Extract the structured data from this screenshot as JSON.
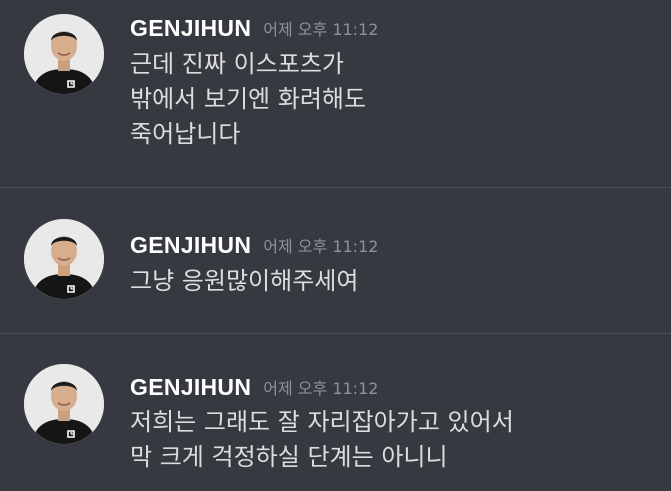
{
  "messages": [
    {
      "username": "GENJIHUN",
      "timestamp": "어제 오후 11:12",
      "lines": [
        "근데 진짜 이스포츠가",
        "밖에서 보기엔 화려해도",
        "죽어납니다"
      ]
    },
    {
      "username": "GENJIHUN",
      "timestamp": "어제 오후 11:12",
      "lines": [
        "그냥 응원많이해주세여"
      ]
    },
    {
      "username": "GENJIHUN",
      "timestamp": "어제 오후 11:12",
      "lines": [
        "저희는 그래도 잘 자리잡아가고 있어서",
        "막 크게 걱정하실 단계는 아니니"
      ]
    }
  ],
  "colors": {
    "background": "#36393f",
    "username": "#ffffff",
    "timestamp": "#8e9297",
    "message_text": "#dcddde",
    "divider": "#4a4d53"
  },
  "icons": {
    "avatar": "user-avatar-photo",
    "shirt_logo": "gen-g-logo-icon"
  }
}
